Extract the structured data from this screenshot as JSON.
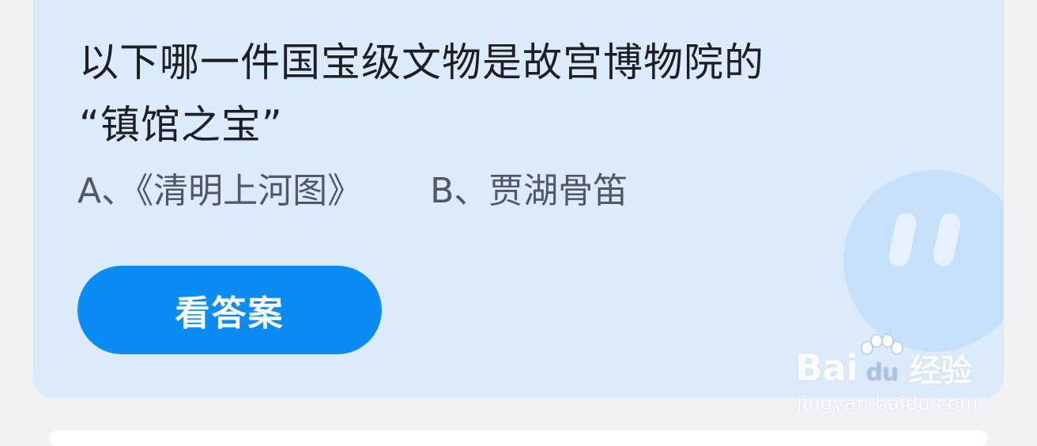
{
  "question": {
    "line1": "以下哪一件国宝级文物是故宫博物院的",
    "line2": "“镇馆之宝”"
  },
  "options": [
    {
      "label": "A、《清明上河图》"
    },
    {
      "label": "B、贾湖骨笛"
    }
  ],
  "answer_button": {
    "label": "看答案"
  },
  "watermark": {
    "logo_prefix": "Bai",
    "logo_paw_text": "du",
    "logo_suffix": "经验",
    "url": "jingyan.baidu.com"
  },
  "colors": {
    "card_background": "#dcebfc",
    "page_background": "#f1f2f4",
    "button": "#0b8cf5",
    "question_text": "#1d1f24",
    "option_text": "#52585f"
  },
  "icons": [
    "mascot-face-icon",
    "baidu-paw-icon"
  ]
}
